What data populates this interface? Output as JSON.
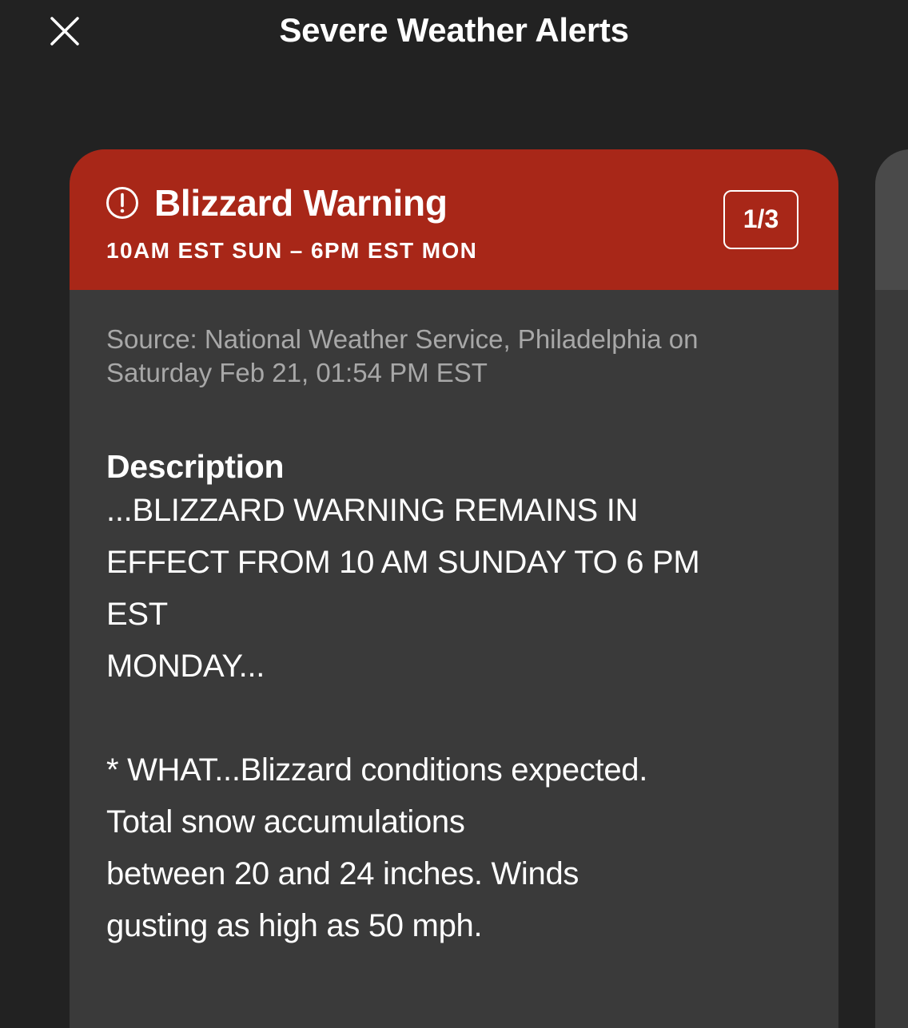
{
  "header": {
    "title": "Severe Weather Alerts",
    "close_icon": "close-icon"
  },
  "alert": {
    "icon": "alert-circle-icon",
    "title": "Blizzard Warning",
    "time_range": "10AM EST SUN – 6PM EST MON",
    "pager": "1/3",
    "source": "Source: National Weather Service, Philadelphia on Saturday Feb 21, 01:54 PM EST",
    "description_heading": "Description",
    "description_text": "...BLIZZARD WARNING REMAINS IN\nEFFECT FROM 10 AM SUNDAY TO 6 PM\nEST\nMONDAY...\n\n* WHAT...Blizzard conditions expected.\nTotal snow accumulations\nbetween 20 and 24 inches. Winds\ngusting as high as 50 mph."
  },
  "colors": {
    "background": "#222222",
    "card": "#3a3a3a",
    "alert_header": "#a82718",
    "source_text": "#a8a8a8"
  }
}
